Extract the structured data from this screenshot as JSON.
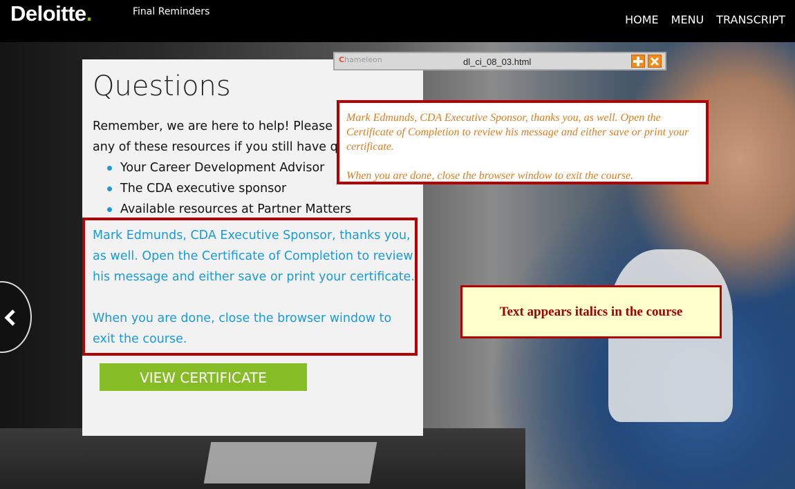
{
  "header": {
    "logo_text": "Deloitte",
    "logo_dot": ".",
    "course_title": "Final Reminders",
    "nav": [
      "HOME",
      "MENU",
      "TRANSCRIPT"
    ]
  },
  "panel": {
    "title": "Questions",
    "intro_line1": "Remember, we are here to help! Please rea",
    "intro_line2": "any of these resources if you still have que",
    "resources": [
      "Your Career Development Advisor",
      "The CDA executive sponsor",
      "Available resources at Partner Matters"
    ],
    "message_p1": "Mark Edmunds, CDA Executive Sponsor, thanks you, as well. Open the Certificate of Completion to review his message and either save or print your certificate.",
    "message_p2": "When you are done, close the browser window to exit the course.",
    "cert_button": "VIEW CERTIFICATE"
  },
  "popup": {
    "logo_text": "hameleon",
    "logo_c": "C",
    "filename": "dl_ci_08_03.html",
    "note_p1": "Mark Edmunds, CDA Executive Sponsor, thanks you, as well. Open the Certificate of Completion to review his message and either save or print your certificate.",
    "note_p2": "When you are done, close the browser window to exit the course."
  },
  "callout": {
    "text": "Text appears italics in the course"
  },
  "colors": {
    "brand_green": "#86bc25",
    "link_blue": "#1a9ad6",
    "highlight_red": "#b40000",
    "note_orange": "#e07d20"
  }
}
